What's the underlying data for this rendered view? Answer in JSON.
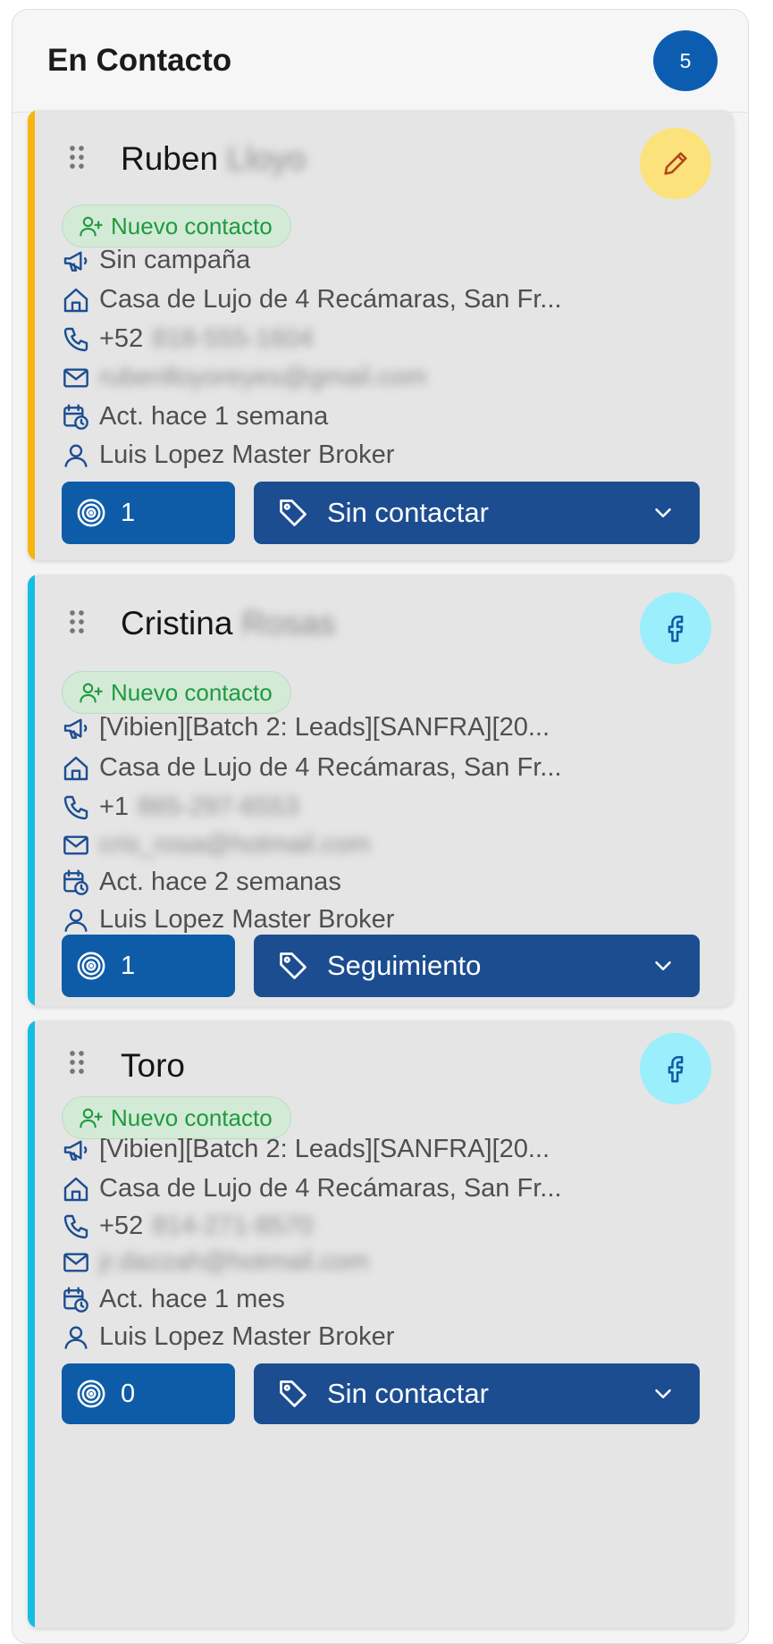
{
  "column": {
    "title": "En Contacto",
    "count": "5"
  },
  "colors": {
    "accent_yellow": "#f7b512",
    "accent_cyan": "#16bde3",
    "brand_blue": "#0e5ca8",
    "status_blue": "#1c4d91",
    "green": "#1f9a3e"
  },
  "cards": [
    {
      "first_name": "Ruben",
      "last_name_blurred": "Lloyo",
      "source_icon": "pencil-icon",
      "badge": "Nuevo contacto",
      "campaign": "Sin campaña",
      "property": "Casa de Lujo de 4 Recámaras, San Fr...",
      "phone_prefix": "+52",
      "phone_blurred": "818-555-1604",
      "email_blurred": "rubenlloyoreyes@gmail.com",
      "activity": "Act. hace 1 semana",
      "agent": "Luis Lopez Master Broker",
      "count": "1",
      "status": "Sin contactar"
    },
    {
      "first_name": "Cristina",
      "last_name_blurred": "Rosas",
      "source_icon": "facebook-icon",
      "badge": "Nuevo contacto",
      "campaign": "[Vibien][Batch 2: Leads][SANFRA][20...",
      "property": "Casa de Lujo de 4 Recámaras, San Fr...",
      "phone_prefix": "+1",
      "phone_blurred": "865-297-6553",
      "email_blurred": "cris_rosa@hotmail.com",
      "activity": "Act. hace 2 semanas",
      "agent": "Luis Lopez Master Broker",
      "count": "1",
      "status": "Seguimiento"
    },
    {
      "first_name": "Toro",
      "last_name_blurred": "",
      "source_icon": "facebook-icon",
      "badge": "Nuevo contacto",
      "campaign": "[Vibien][Batch 2: Leads][SANFRA][20...",
      "property": "Casa de Lujo de 4 Recámaras, San Fr...",
      "phone_prefix": "+52",
      "phone_blurred": "814-271-8570",
      "email_blurred": "jr.dazzah@hotmail.com",
      "activity": "Act. hace 1 mes",
      "agent": "Luis Lopez Master Broker",
      "count": "0",
      "status": "Sin contactar"
    }
  ]
}
